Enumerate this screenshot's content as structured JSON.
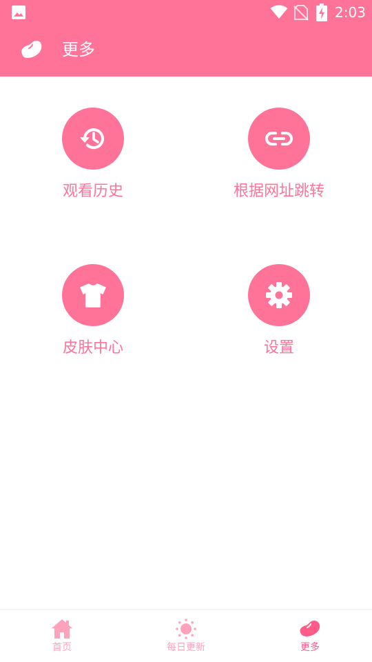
{
  "status_bar": {
    "time": "2:03",
    "icons": [
      "gallery-icon",
      "wifi-icon",
      "no-sim-icon",
      "battery-charging-icon"
    ]
  },
  "header": {
    "title": "更多",
    "logo_icon": "bean-icon"
  },
  "menu": {
    "items": [
      {
        "label": "观看历史",
        "icon": "history-icon"
      },
      {
        "label": "根据网址跳转",
        "icon": "link-icon"
      },
      {
        "label": "皮肤中心",
        "icon": "tshirt-icon"
      },
      {
        "label": "设置",
        "icon": "gear-icon"
      }
    ]
  },
  "bottom_nav": {
    "items": [
      {
        "label": "首页",
        "icon": "home-icon",
        "active": false
      },
      {
        "label": "每日更新",
        "icon": "sun-icon",
        "active": false
      },
      {
        "label": "更多",
        "icon": "bean-icon",
        "active": true
      }
    ]
  },
  "colors": {
    "accent": "#ff7399",
    "nav_inactive": "#ffa3bd",
    "nav_active": "#ff5c8a",
    "background": "#ffffff"
  }
}
